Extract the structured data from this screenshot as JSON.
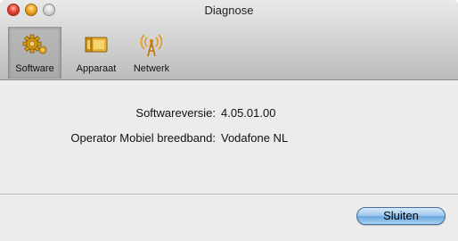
{
  "window": {
    "title": "Diagnose"
  },
  "toolbar": {
    "items": [
      {
        "label": "Software",
        "icon": "gear-icon",
        "selected": true
      },
      {
        "label": "Apparaat",
        "icon": "device-card-icon",
        "selected": false
      },
      {
        "label": "Netwerk",
        "icon": "antenna-icon",
        "selected": false
      }
    ]
  },
  "info": [
    {
      "label": "Softwareversie:",
      "value": "4.05.01.00"
    },
    {
      "label": "Operator Mobiel breedband:",
      "value": "Vodafone NL"
    }
  ],
  "footer": {
    "close_label": "Sluiten"
  },
  "colors": {
    "close_button": "#e8483b",
    "minimize_button": "#f3a724",
    "default_button": "#9cc8ef"
  }
}
